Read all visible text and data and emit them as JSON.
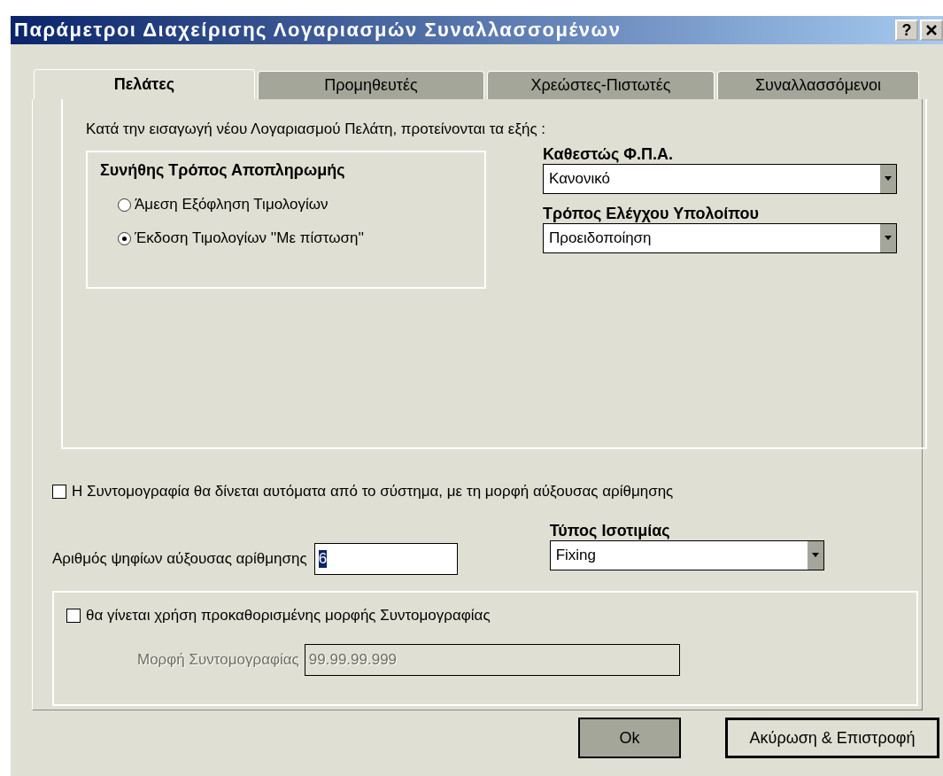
{
  "window": {
    "title": "Παράμετροι Διαχείρισης Λογαριασμών Συναλλασσομένων",
    "help_button": "?"
  },
  "tabs": [
    {
      "label": "Πελάτες",
      "selected": true
    },
    {
      "label": "Προμηθευτές",
      "selected": false
    },
    {
      "label": "Χρεώστες-Πιστωτές",
      "selected": false
    },
    {
      "label": "Συναλλασσόμενοι",
      "selected": false
    }
  ],
  "intro": "Κατά την εισαγωγή νέου Λογαριασμού Πελάτη, προτείνονται τα εξής :",
  "payment_group": {
    "title": "Συνήθης Τρόπος Αποπληρωμής",
    "options": [
      {
        "label": "Άμεση Εξόφληση Τιμολογίων",
        "selected": false
      },
      {
        "label": "Έκδοση Τιμολογίων ''Με πίστωση''",
        "selected": true
      }
    ]
  },
  "vat_status": {
    "label": "Καθεστώς Φ.Π.Α.",
    "value": "Κανονικό"
  },
  "balance_check": {
    "label": "Τρόπος Ελέγχου Υπολοίπου",
    "value": "Προειδοποίηση"
  },
  "auto_code": {
    "label": "Η Συντομογραφία θα δίνεται αυτόματα από το σύστημα, με τη μορφή αύξουσας αρίθμησης",
    "checked": false
  },
  "digits": {
    "label": "Αριθμός ψηφίων αύξουσας αρίθμησης",
    "value": "6"
  },
  "exchange_type": {
    "label": "Τύπος Ισοτιμίας",
    "value": "Fixing"
  },
  "predefined": {
    "label": "θα γίνεται χρήση προκαθορισμένης μορφής Συντομογραφίας",
    "checked": false
  },
  "format": {
    "label": "Μορφή Συντομογραφίας",
    "value": "99.99.99.999",
    "disabled": true
  },
  "buttons": [
    "Ok",
    "Ακύρωση & Επιστροφή"
  ]
}
